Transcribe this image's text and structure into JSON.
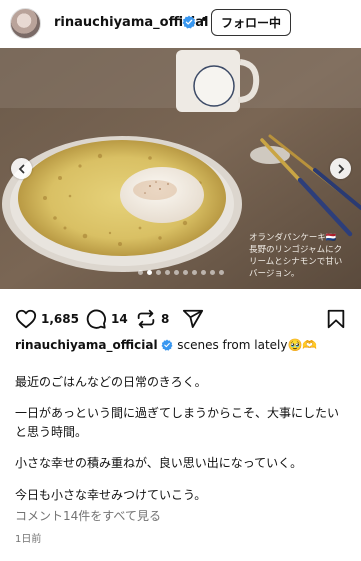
{
  "header": {
    "username": "rinauchiyama_official",
    "separator": "•",
    "follow_label": "フォロー中"
  },
  "photo": {
    "overlay_text": "オランダパンケーキ🇳🇱\n長野のリンゴジャムにク\nリームとシナモンで甘い\nバージョン。",
    "carousel_count": 10,
    "carousel_active_index": 1
  },
  "actions": {
    "likes": "1,685",
    "comments": "14",
    "reposts": "8"
  },
  "caption": {
    "username": "rinauchiyama_official",
    "text": "scenes from lately🥹🫶",
    "lines": [
      "最近のごはんなどの日常のきろく。",
      "一日があっという間に過ぎてしまうからこそ、大事にしたいと思う時間。",
      "小さな幸せの積み重ねが、良い思い出になっていく。",
      "今日も小さな幸せみつけていこう。"
    ]
  },
  "comments_link": "コメント14件をすべて見る",
  "time_ago": "1日前",
  "icons": {
    "like": "heart-icon",
    "comment": "comment-bubble-icon",
    "repost": "repost-icon",
    "share": "send-icon",
    "save": "bookmark-icon",
    "verified": "verified-badge-icon"
  },
  "colors": {
    "verified_blue": "#3897f0",
    "secondary_text": "#737373"
  }
}
